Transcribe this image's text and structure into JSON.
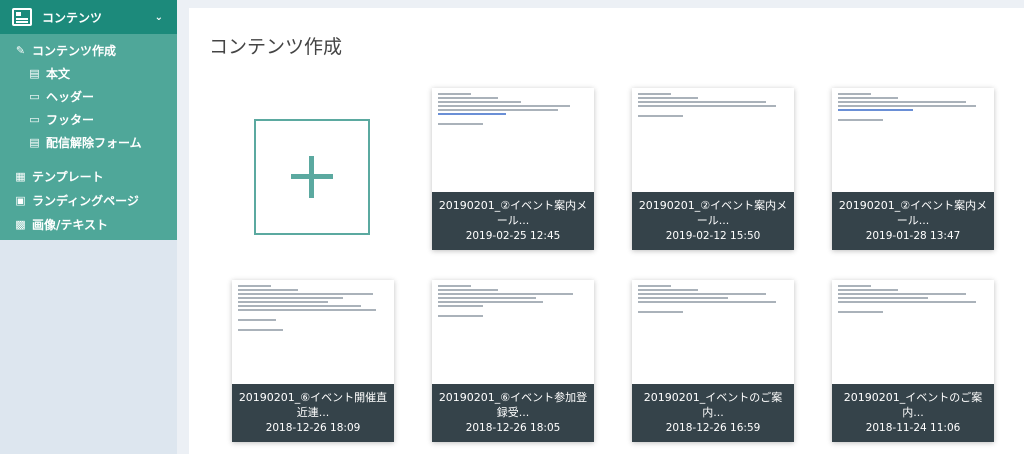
{
  "sidebar": {
    "header": {
      "label": "コンテンツ",
      "icon": "layout-icon",
      "chevron": "chevron-down-icon"
    },
    "items": [
      {
        "label": "コンテンツ作成",
        "icon": "edit-icon"
      },
      {
        "label": "本文",
        "icon": "document-icon"
      },
      {
        "label": "ヘッダー",
        "icon": "document-icon"
      },
      {
        "label": "フッター",
        "icon": "document-icon"
      },
      {
        "label": "配信解除フォーム",
        "icon": "document-icon"
      },
      {
        "label": "テンプレート",
        "icon": "template-icon"
      },
      {
        "label": "ランディングページ",
        "icon": "landing-page-icon"
      },
      {
        "label": "画像/テキスト",
        "icon": "image-icon"
      }
    ],
    "colors": {
      "header_bg": "#1c8a7b",
      "body_bg": "#4fa799",
      "base_bg": "#dde6ef"
    }
  },
  "main": {
    "title": "コンテンツ作成",
    "new_button_icon": "plus-icon",
    "accent": "#5ba9a0",
    "caption_bg": "#35434a"
  },
  "cards": [
    {
      "title": "20190201_②イベント案内メール...",
      "date": "2019-02-25 12:45"
    },
    {
      "title": "20190201_②イベント案内メール...",
      "date": "2019-02-12 15:50"
    },
    {
      "title": "20190201_②イベント案内メール...",
      "date": "2019-01-28 13:47"
    },
    {
      "title": "20190201_⑥イベント開催直近連...",
      "date": "2018-12-26 18:09"
    },
    {
      "title": "20190201_⑥イベント参加登録受...",
      "date": "2018-12-26 18:05"
    },
    {
      "title": "20190201_イベントのご案内...",
      "date": "2018-12-26 16:59"
    },
    {
      "title": "20190201_イベントのご案内...",
      "date": "2018-11-24 11:06"
    }
  ]
}
